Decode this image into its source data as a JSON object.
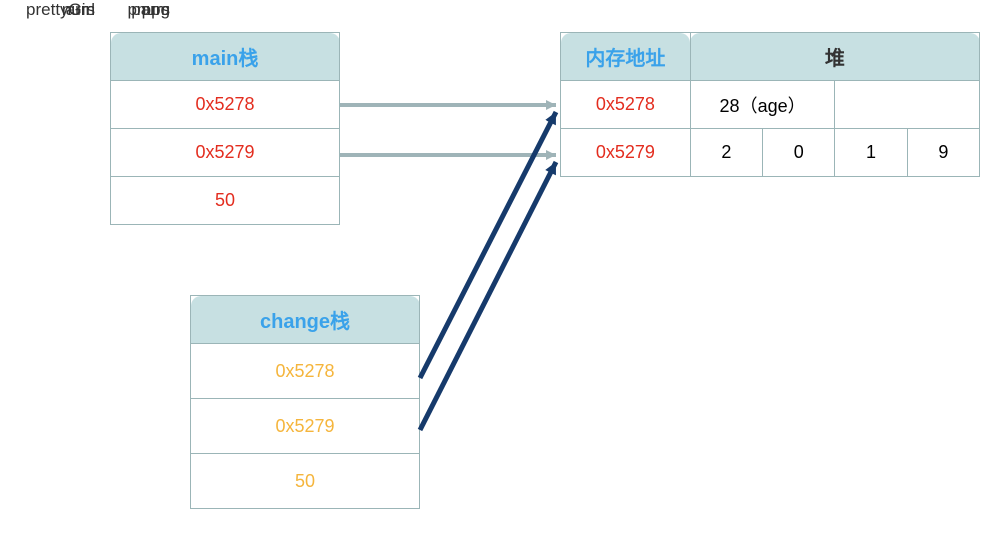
{
  "main_stack": {
    "title": "main栈",
    "rows": [
      {
        "label": "prettyGirl",
        "value": "0x5278"
      },
      {
        "label": "arrs",
        "value": "0x5279"
      },
      {
        "label": "num",
        "value": "50"
      }
    ]
  },
  "change_stack": {
    "title": "change栈",
    "rows": [
      {
        "label": "ppg",
        "value": "0x5278"
      },
      {
        "label": "parrs",
        "value": "0x5279"
      },
      {
        "label": "pnum",
        "value": "50"
      }
    ]
  },
  "heap": {
    "addr_header": "内存地址",
    "heap_header": "堆",
    "rows": [
      {
        "addr": "0x5278",
        "cells": [
          "28（age）",
          "",
          "",
          ""
        ]
      },
      {
        "addr": "0x5279",
        "cells": [
          "2",
          "0",
          "1",
          "9"
        ]
      }
    ]
  }
}
